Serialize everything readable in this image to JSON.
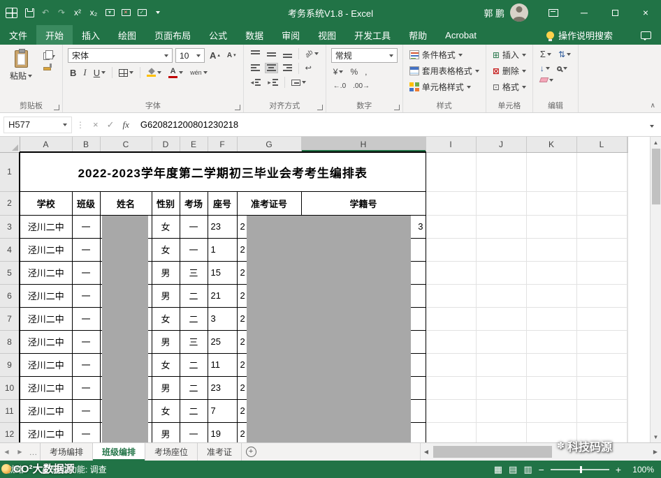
{
  "colors": {
    "excel_green": "#217346",
    "active_tab_green": "#3a8a5f",
    "redaction_gray": "#A8A8A8",
    "font_color_red": "#C00000",
    "fill_color_yellow": "#FFC000"
  },
  "titlebar": {
    "title": "考务系统V1.8 - Excel",
    "user": "郭 鹏",
    "superscript": "x²",
    "subscript": "x₂"
  },
  "ribbon": {
    "tabs": [
      {
        "id": "file",
        "label": "文件"
      },
      {
        "id": "home",
        "label": "开始",
        "active": true
      },
      {
        "id": "insert",
        "label": "插入"
      },
      {
        "id": "draw",
        "label": "绘图"
      },
      {
        "id": "page-layout",
        "label": "页面布局"
      },
      {
        "id": "formulas",
        "label": "公式"
      },
      {
        "id": "data",
        "label": "数据"
      },
      {
        "id": "review",
        "label": "审阅"
      },
      {
        "id": "view",
        "label": "视图"
      },
      {
        "id": "developer",
        "label": "开发工具"
      },
      {
        "id": "help",
        "label": "帮助"
      },
      {
        "id": "acrobat",
        "label": "Acrobat"
      }
    ],
    "search_placeholder": "操作说明搜索",
    "groups": {
      "clipboard": {
        "label": "剪贴板",
        "paste": "粘贴"
      },
      "font": {
        "label": "字体",
        "name": "宋体",
        "size": "10"
      },
      "alignment": {
        "label": "对齐方式"
      },
      "number": {
        "label": "数字",
        "format": "常规"
      },
      "styles": {
        "label": "样式",
        "conditional": "条件格式",
        "table_format": "套用表格格式",
        "cell_styles": "单元格样式"
      },
      "cells": {
        "label": "单元格",
        "insert": "插入",
        "delete": "删除",
        "format": "格式"
      },
      "editing": {
        "label": "编辑"
      }
    }
  },
  "formula_bar": {
    "name_box": "H577",
    "formula": "G620821200801230218"
  },
  "sheet": {
    "columns": [
      "A",
      "B",
      "C",
      "D",
      "E",
      "F",
      "G",
      "H",
      "I",
      "J",
      "K",
      "L"
    ],
    "selected_column": "H",
    "title_row": "2022-2023学年度第二学期初三毕业会考考生编排表",
    "header_row": [
      "学校",
      "班级",
      "姓名",
      "性别",
      "考场",
      "座号",
      "准考证号",
      "学籍号"
    ],
    "rows": [
      {
        "school": "泾川二中",
        "class_name": "一",
        "name": "",
        "gender": "女",
        "room": "一",
        "seat": "23",
        "exam_prefix": "2",
        "id_suffix": "3"
      },
      {
        "school": "泾川二中",
        "class_name": "一",
        "name": "",
        "gender": "女",
        "room": "一",
        "seat": "1",
        "exam_prefix": "2",
        "id_suffix": ""
      },
      {
        "school": "泾川二中",
        "class_name": "一",
        "name": "",
        "gender": "男",
        "room": "三",
        "seat": "15",
        "exam_prefix": "2",
        "id_suffix": ""
      },
      {
        "school": "泾川二中",
        "class_name": "一",
        "name": "",
        "gender": "男",
        "room": "二",
        "seat": "21",
        "exam_prefix": "2",
        "id_suffix": ""
      },
      {
        "school": "泾川二中",
        "class_name": "一",
        "name": "",
        "gender": "女",
        "room": "二",
        "seat": "3",
        "exam_prefix": "2",
        "id_suffix": ""
      },
      {
        "school": "泾川二中",
        "class_name": "一",
        "name": "",
        "gender": "男",
        "room": "三",
        "seat": "25",
        "exam_prefix": "2",
        "id_suffix": ""
      },
      {
        "school": "泾川二中",
        "class_name": "一",
        "name": "",
        "gender": "女",
        "room": "二",
        "seat": "11",
        "exam_prefix": "2",
        "id_suffix": ""
      },
      {
        "school": "泾川二中",
        "class_name": "一",
        "name": "",
        "gender": "男",
        "room": "二",
        "seat": "23",
        "exam_prefix": "2",
        "id_suffix": ""
      },
      {
        "school": "泾川二中",
        "class_name": "一",
        "name": "",
        "gender": "女",
        "room": "二",
        "seat": "7",
        "exam_prefix": "2",
        "id_suffix": ""
      },
      {
        "school": "泾川二中",
        "class_name": "一",
        "name": "",
        "gender": "男",
        "room": "一",
        "seat": "19",
        "exam_prefix": "2",
        "id_suffix": ""
      }
    ]
  },
  "sheet_tabs": {
    "tabs": [
      {
        "id": "exam-room-arrangement",
        "label": "考场编排"
      },
      {
        "id": "class-arrangement",
        "label": "班级编排",
        "active": true
      },
      {
        "id": "exam-room-seating",
        "label": "考场座位"
      },
      {
        "id": "admission-ticket",
        "label": "准考证"
      }
    ]
  },
  "status_bar": {
    "ready": "就绪",
    "accessibility": "辅助功能: 调查",
    "zoom": "100%"
  },
  "watermarks": {
    "bottom_right": "科技码源",
    "bottom_left": "CO²大数据源"
  }
}
